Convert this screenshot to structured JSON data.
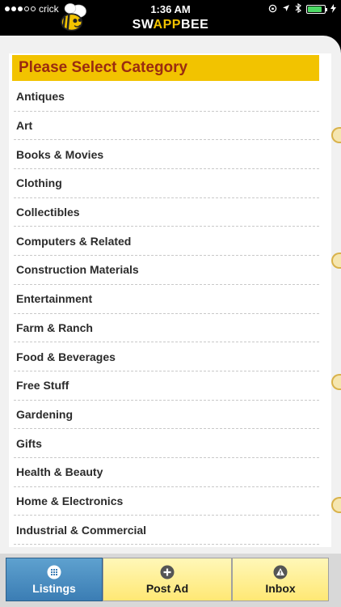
{
  "status_bar": {
    "carrier": "crick",
    "time": "1:36 AM"
  },
  "app": {
    "brand_prefix": "SW",
    "brand_mid": "APP",
    "brand_suffix": "BEE"
  },
  "category": {
    "header": "Please Select Category",
    "items": [
      "Antiques",
      "Art",
      "Books & Movies",
      "Clothing",
      "Collectibles",
      "Computers & Related",
      "Construction Materials",
      "Entertainment",
      "Farm & Ranch",
      "Food & Beverages",
      "Free Stuff",
      "Gardening",
      "Gifts",
      "Health & Beauty",
      "Home & Electronics",
      "Industrial & Commercial"
    ]
  },
  "tabs": [
    {
      "label": "Listings",
      "icon": "grid-icon",
      "active": true
    },
    {
      "label": "Post Ad",
      "icon": "plus-circle-icon",
      "active": false
    },
    {
      "label": "Inbox",
      "icon": "warning-icon",
      "active": false
    }
  ],
  "colors": {
    "accent_yellow": "#f2c300",
    "header_text": "#9a2b10",
    "active_tab": "#3b7db4"
  }
}
